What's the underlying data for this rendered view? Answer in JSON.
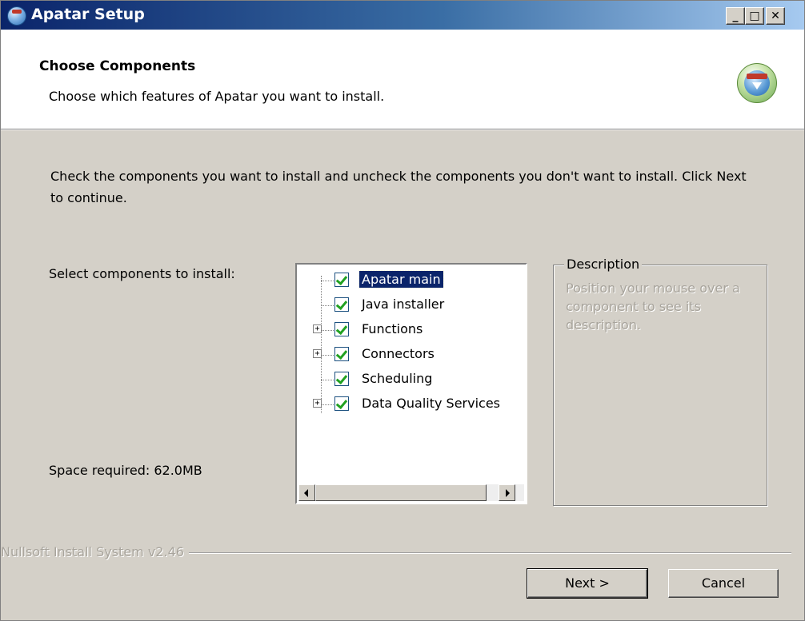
{
  "window": {
    "title": "Apatar Setup"
  },
  "titlebar_buttons": {
    "minimize": "_",
    "maximize": "□",
    "close": "✕"
  },
  "header": {
    "title": "Choose Components",
    "subtitle": "Choose which features of Apatar you want to install."
  },
  "body": {
    "instructions": "Check the components you want to install and uncheck the components you don't want to install. Click Next to continue.",
    "select_label": "Select components to install:",
    "space_required": "Space required: 62.0MB"
  },
  "components": [
    {
      "label": "Apatar main",
      "checked": true,
      "expandable": false,
      "selected": true
    },
    {
      "label": "Java installer",
      "checked": true,
      "expandable": false,
      "selected": false
    },
    {
      "label": "Functions",
      "checked": true,
      "expandable": true,
      "selected": false
    },
    {
      "label": "Connectors",
      "checked": true,
      "expandable": true,
      "selected": false
    },
    {
      "label": "Scheduling",
      "checked": true,
      "expandable": false,
      "selected": false
    },
    {
      "label": "Data Quality Services",
      "checked": true,
      "expandable": true,
      "selected": false
    }
  ],
  "description": {
    "legend": "Description",
    "text": "Position your mouse over a component to see its description."
  },
  "footer": {
    "branding": "Nullsoft Install System v2.46",
    "next_label": "Next >",
    "cancel_label": "Cancel"
  },
  "colors": {
    "titlebar_start": "#0a246a",
    "selection": "#0a246a",
    "face": "#d4d0c8"
  }
}
